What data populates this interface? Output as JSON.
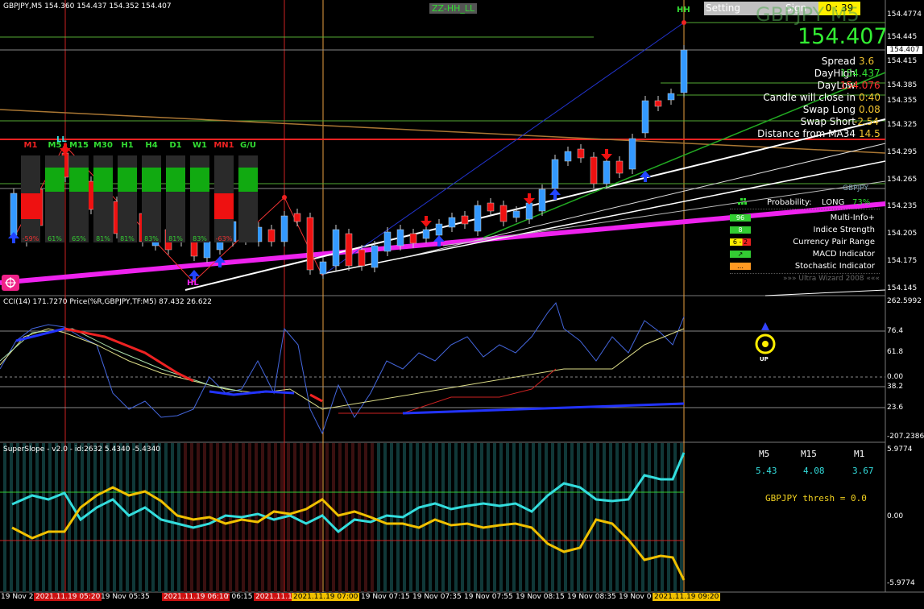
{
  "chart": {
    "header": "GBPJPY,M5  154.360 154.437 154.352 154.407",
    "zigzag_label": "ZZ-HH_LL",
    "hh_label": "HH",
    "ll_label": "LL",
    "hl_label": "HL",
    "setting_button": "Setting Contents",
    "signal_button": "Sign No",
    "countdown": "0 : 39",
    "symbol_title": "GBPJPY M5",
    "current_price": "154.407",
    "price_axis": [
      "154.4774",
      "154.445",
      "154.415",
      "154.385",
      "154.355",
      "154.325",
      "154.295",
      "154.265",
      "154.235",
      "154.205",
      "154.175",
      "154.145"
    ],
    "price_marker": "154.407",
    "info": [
      {
        "label": "Spread",
        "value": "3.6",
        "color": "#f4c430"
      },
      {
        "label": "DayHigh",
        "value": "154.437",
        "color": "#33dd33"
      },
      {
        "label": "DayLow",
        "value": "154.076",
        "color": "#ff3030"
      },
      {
        "label": "Candle will close in",
        "value": "0:40",
        "color": "#f4c430"
      },
      {
        "label": "Swap Long",
        "value": "0.08",
        "color": "#f4c430"
      },
      {
        "label": "Swap Short",
        "value": "-2.54",
        "color": "#f4c430"
      },
      {
        "label": "Distance from MA34",
        "value": "14.5",
        "color": "#f4c430"
      }
    ],
    "timeframes": [
      "M1",
      "M5",
      "M15",
      "M30",
      "H1",
      "H4",
      "D1",
      "W1",
      "MN1",
      "G/U"
    ],
    "tf_percent": [
      "-59%",
      "61%",
      "65%",
      "81%",
      "81%",
      "83%",
      "81%",
      "83%",
      "-63%"
    ],
    "wizard": {
      "pair": "GBPJPY",
      "probability_label": "Probability:",
      "direction": "LONG",
      "probability": "73%",
      "rows": [
        {
          "badge": "96",
          "label": "Multi-Info+"
        },
        {
          "badge": "8",
          "label": "Indice Strength"
        },
        {
          "badge": "6 - 2",
          "label": "Currency Pair Range"
        },
        {
          "badge": "↗",
          "label": "MACD Indicator"
        },
        {
          "badge": "…",
          "label": "Stochastic Indicator"
        }
      ],
      "footer": "»»» Ultra Wizard 2008 «««"
    }
  },
  "cci": {
    "header": "CCI(14) 171.7270  Price(%R,GBPJPY,TF:M5) 87.432 26.622",
    "axis": [
      "262.5992",
      "76.4",
      "61.8",
      "0.00",
      "38.2",
      "23.6",
      "-207.2386"
    ],
    "signal": "UP"
  },
  "slope": {
    "header": "SuperSlope - v2.0 - id:2632 5.4340 -5.4340",
    "axis": [
      "5.9774",
      "0.00",
      "-5.9774"
    ],
    "tf_headers": [
      "M5",
      "M15",
      "M1"
    ],
    "tf_values": [
      "5.43",
      "4.08",
      "3.67"
    ],
    "thresh": "GBPJPY thresh = 0.0"
  },
  "time_axis": [
    "19 Nov 2",
    "2021.11.19 05:20",
    "19 Nov 05:35",
    "2021.11.19 06:10",
    "r 06:15",
    "2021.11.1",
    "2021.11.19 07:00",
    "19 Nov 07:15",
    "19 Nov 07:35",
    "19 Nov 07:55",
    "19 Nov 08:15",
    "19 Nov 08:35",
    "19 Nov 0",
    "2021.11.19 09:20"
  ],
  "colors": {
    "up": "#3399ff",
    "down": "#ee1111",
    "magenta": "#ee22ee",
    "lime": "#22dd22",
    "cyan": "#33dddd",
    "gold": "#f0c000"
  }
}
